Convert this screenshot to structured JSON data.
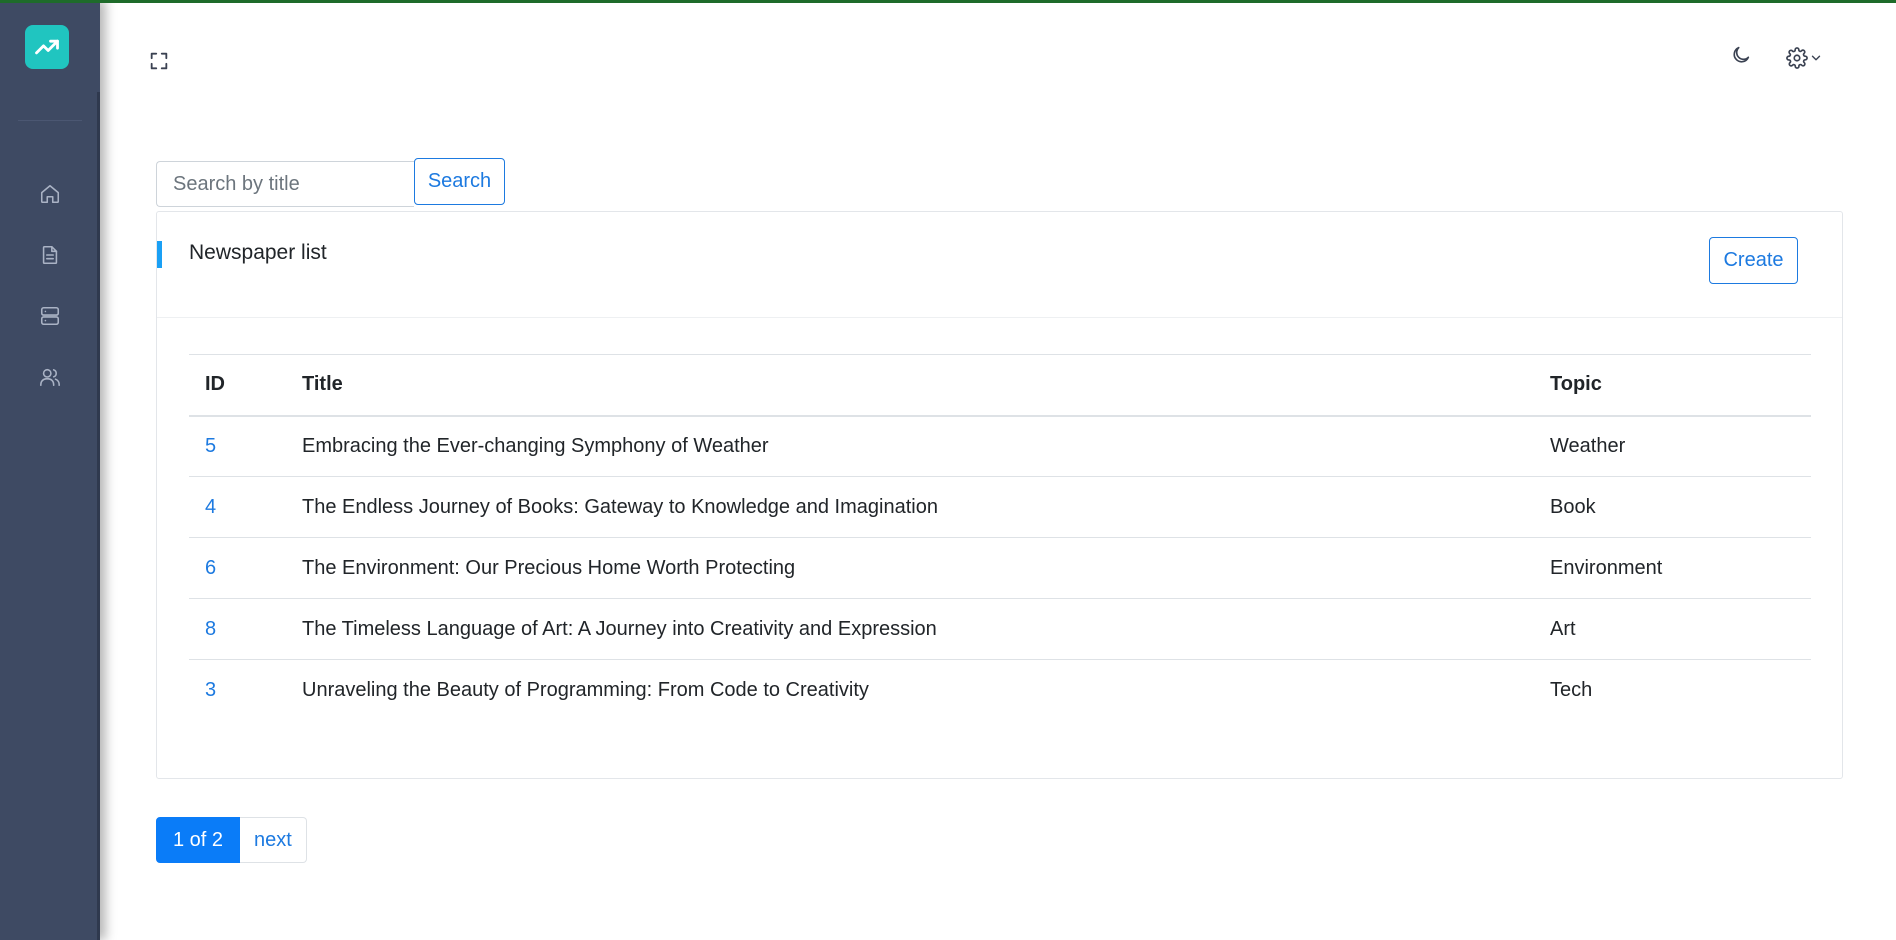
{
  "sidebar": {
    "logo_icon": "trending-up-icon",
    "nav": [
      {
        "name": "home",
        "icon": "home-icon"
      },
      {
        "name": "documents",
        "icon": "document-icon"
      },
      {
        "name": "servers",
        "icon": "server-icon"
      },
      {
        "name": "users",
        "icon": "users-icon"
      }
    ]
  },
  "header": {
    "fullscreen_icon": "fullscreen-icon",
    "theme_icon": "moon-icon",
    "settings_icon": "gear-icon"
  },
  "search": {
    "placeholder": "Search by title",
    "value": "",
    "button_label": "Search"
  },
  "card": {
    "title": "Newspaper list",
    "create_label": "Create"
  },
  "table": {
    "columns": [
      "ID",
      "Title",
      "Topic"
    ],
    "rows": [
      {
        "id": "5",
        "title": "Embracing the Ever-changing Symphony of Weather",
        "topic": "Weather"
      },
      {
        "id": "4",
        "title": "The Endless Journey of Books: Gateway to Knowledge and Imagination",
        "topic": "Book"
      },
      {
        "id": "6",
        "title": "The Environment: Our Precious Home Worth Protecting",
        "topic": "Environment"
      },
      {
        "id": "8",
        "title": "The Timeless Language of Art: A Journey into Creativity and Expression",
        "topic": "Art"
      },
      {
        "id": "3",
        "title": "Unraveling the Beauty of Programming: From Code to Creativity",
        "topic": "Tech"
      }
    ]
  },
  "pagination": {
    "current": "1 of 2",
    "next_label": "next"
  },
  "colors": {
    "sidebar_bg": "#3e4a63",
    "logo_bg": "#20c5c0",
    "accent": "#1d7ae0",
    "active_page": "#0a7cf8",
    "title_accent": "#1aa0f5"
  }
}
